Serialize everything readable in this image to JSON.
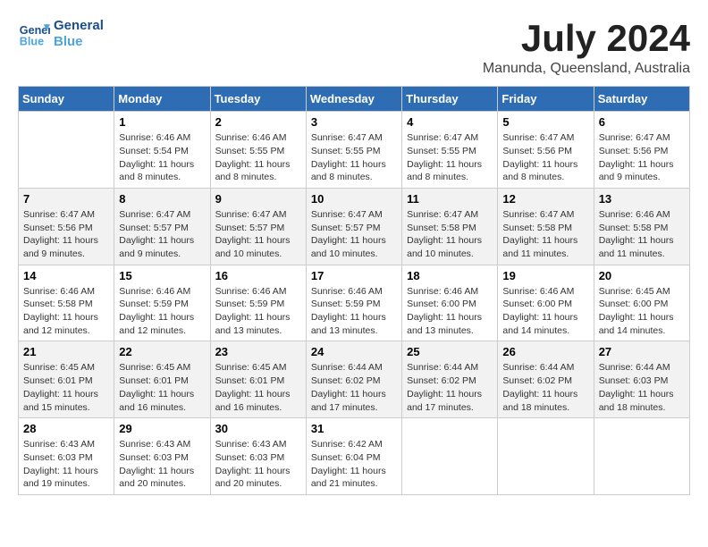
{
  "header": {
    "logo_line1": "General",
    "logo_line2": "Blue",
    "title": "July 2024",
    "subtitle": "Manunda, Queensland, Australia"
  },
  "weekdays": [
    "Sunday",
    "Monday",
    "Tuesday",
    "Wednesday",
    "Thursday",
    "Friday",
    "Saturday"
  ],
  "weeks": [
    [
      {
        "day": "",
        "info": ""
      },
      {
        "day": "1",
        "info": "Sunrise: 6:46 AM\nSunset: 5:54 PM\nDaylight: 11 hours\nand 8 minutes."
      },
      {
        "day": "2",
        "info": "Sunrise: 6:46 AM\nSunset: 5:55 PM\nDaylight: 11 hours\nand 8 minutes."
      },
      {
        "day": "3",
        "info": "Sunrise: 6:47 AM\nSunset: 5:55 PM\nDaylight: 11 hours\nand 8 minutes."
      },
      {
        "day": "4",
        "info": "Sunrise: 6:47 AM\nSunset: 5:55 PM\nDaylight: 11 hours\nand 8 minutes."
      },
      {
        "day": "5",
        "info": "Sunrise: 6:47 AM\nSunset: 5:56 PM\nDaylight: 11 hours\nand 8 minutes."
      },
      {
        "day": "6",
        "info": "Sunrise: 6:47 AM\nSunset: 5:56 PM\nDaylight: 11 hours\nand 9 minutes."
      }
    ],
    [
      {
        "day": "7",
        "info": "Sunrise: 6:47 AM\nSunset: 5:56 PM\nDaylight: 11 hours\nand 9 minutes."
      },
      {
        "day": "8",
        "info": "Sunrise: 6:47 AM\nSunset: 5:57 PM\nDaylight: 11 hours\nand 9 minutes."
      },
      {
        "day": "9",
        "info": "Sunrise: 6:47 AM\nSunset: 5:57 PM\nDaylight: 11 hours\nand 10 minutes."
      },
      {
        "day": "10",
        "info": "Sunrise: 6:47 AM\nSunset: 5:57 PM\nDaylight: 11 hours\nand 10 minutes."
      },
      {
        "day": "11",
        "info": "Sunrise: 6:47 AM\nSunset: 5:58 PM\nDaylight: 11 hours\nand 10 minutes."
      },
      {
        "day": "12",
        "info": "Sunrise: 6:47 AM\nSunset: 5:58 PM\nDaylight: 11 hours\nand 11 minutes."
      },
      {
        "day": "13",
        "info": "Sunrise: 6:46 AM\nSunset: 5:58 PM\nDaylight: 11 hours\nand 11 minutes."
      }
    ],
    [
      {
        "day": "14",
        "info": "Sunrise: 6:46 AM\nSunset: 5:58 PM\nDaylight: 11 hours\nand 12 minutes."
      },
      {
        "day": "15",
        "info": "Sunrise: 6:46 AM\nSunset: 5:59 PM\nDaylight: 11 hours\nand 12 minutes."
      },
      {
        "day": "16",
        "info": "Sunrise: 6:46 AM\nSunset: 5:59 PM\nDaylight: 11 hours\nand 13 minutes."
      },
      {
        "day": "17",
        "info": "Sunrise: 6:46 AM\nSunset: 5:59 PM\nDaylight: 11 hours\nand 13 minutes."
      },
      {
        "day": "18",
        "info": "Sunrise: 6:46 AM\nSunset: 6:00 PM\nDaylight: 11 hours\nand 13 minutes."
      },
      {
        "day": "19",
        "info": "Sunrise: 6:46 AM\nSunset: 6:00 PM\nDaylight: 11 hours\nand 14 minutes."
      },
      {
        "day": "20",
        "info": "Sunrise: 6:45 AM\nSunset: 6:00 PM\nDaylight: 11 hours\nand 14 minutes."
      }
    ],
    [
      {
        "day": "21",
        "info": "Sunrise: 6:45 AM\nSunset: 6:01 PM\nDaylight: 11 hours\nand 15 minutes."
      },
      {
        "day": "22",
        "info": "Sunrise: 6:45 AM\nSunset: 6:01 PM\nDaylight: 11 hours\nand 16 minutes."
      },
      {
        "day": "23",
        "info": "Sunrise: 6:45 AM\nSunset: 6:01 PM\nDaylight: 11 hours\nand 16 minutes."
      },
      {
        "day": "24",
        "info": "Sunrise: 6:44 AM\nSunset: 6:02 PM\nDaylight: 11 hours\nand 17 minutes."
      },
      {
        "day": "25",
        "info": "Sunrise: 6:44 AM\nSunset: 6:02 PM\nDaylight: 11 hours\nand 17 minutes."
      },
      {
        "day": "26",
        "info": "Sunrise: 6:44 AM\nSunset: 6:02 PM\nDaylight: 11 hours\nand 18 minutes."
      },
      {
        "day": "27",
        "info": "Sunrise: 6:44 AM\nSunset: 6:03 PM\nDaylight: 11 hours\nand 18 minutes."
      }
    ],
    [
      {
        "day": "28",
        "info": "Sunrise: 6:43 AM\nSunset: 6:03 PM\nDaylight: 11 hours\nand 19 minutes."
      },
      {
        "day": "29",
        "info": "Sunrise: 6:43 AM\nSunset: 6:03 PM\nDaylight: 11 hours\nand 20 minutes."
      },
      {
        "day": "30",
        "info": "Sunrise: 6:43 AM\nSunset: 6:03 PM\nDaylight: 11 hours\nand 20 minutes."
      },
      {
        "day": "31",
        "info": "Sunrise: 6:42 AM\nSunset: 6:04 PM\nDaylight: 11 hours\nand 21 minutes."
      },
      {
        "day": "",
        "info": ""
      },
      {
        "day": "",
        "info": ""
      },
      {
        "day": "",
        "info": ""
      }
    ]
  ]
}
